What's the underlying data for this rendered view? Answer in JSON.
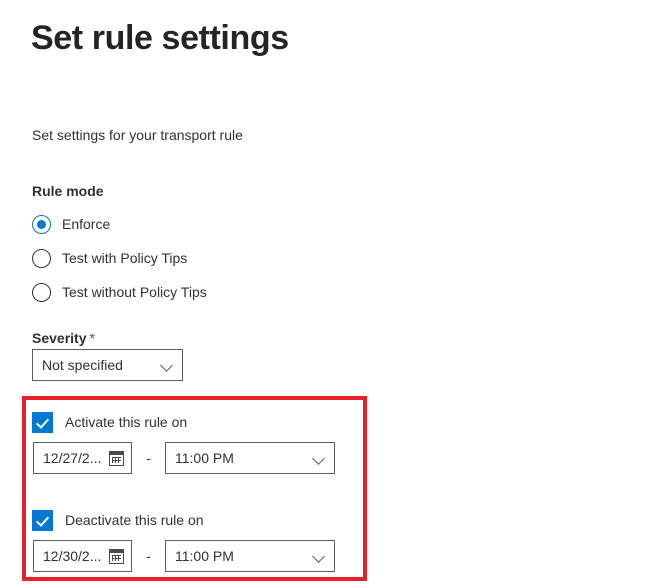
{
  "page": {
    "title": "Set rule settings",
    "subtitle": "Set settings for your transport rule"
  },
  "rule_mode": {
    "label": "Rule mode",
    "options": [
      {
        "label": "Enforce",
        "selected": true
      },
      {
        "label": "Test with Policy Tips",
        "selected": false
      },
      {
        "label": "Test without Policy Tips",
        "selected": false
      }
    ]
  },
  "severity": {
    "label": "Severity",
    "required_marker": "*",
    "value": "Not specified",
    "chevron_icon": "chevron-down-icon"
  },
  "activate": {
    "checkbox_label": "Activate this rule on",
    "checked": true,
    "date_value": "12/27/2...",
    "calendar_icon": "calendar-icon",
    "separator": "-",
    "time_value": "11:00 PM",
    "chevron_icon": "chevron-down-icon"
  },
  "deactivate": {
    "checkbox_label": "Deactivate this rule on",
    "checked": true,
    "date_value": "12/30/2...",
    "calendar_icon": "calendar-icon",
    "separator": "-",
    "time_value": "11:00 PM",
    "chevron_icon": "chevron-down-icon"
  },
  "colors": {
    "accent_blue": "#0078d4",
    "highlight_red": "#e8202a",
    "required_red": "#a4262c",
    "text": "#323130",
    "border": "#605e5c"
  }
}
